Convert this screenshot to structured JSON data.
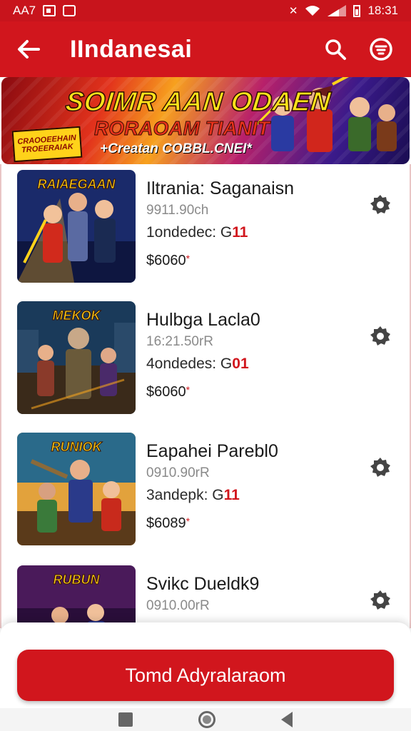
{
  "status_bar": {
    "carrier": "AA7",
    "time": "18:31"
  },
  "app_bar": {
    "title": "IIndanesai",
    "back_icon": "arrow-left-icon",
    "search_icon": "search-icon",
    "filter_icon": "filter-icon"
  },
  "banner": {
    "title": "SOIMR AAN ODAEN",
    "subtitle": "RORAOAM TIANIT",
    "tagline": "+Creatan COBBL.CNEI*",
    "badge_line1": "CRAOOEEHAIN",
    "badge_line2": "TROEERAIAK"
  },
  "games": [
    {
      "title": "Iltrania: Saganaisn",
      "meta": "9911.90ch",
      "line_prefix": "1ondedec: G",
      "line_highlight": "11",
      "price": "$6060",
      "thumb_logo": "RAIAEGAAN",
      "palette": [
        "#1a2a6a",
        "#d12a1c",
        "#f7b21e"
      ]
    },
    {
      "title": "Hulbga Laclа0",
      "meta": "16:21.50rR",
      "line_prefix": "4ondedes: G",
      "line_highlight": "01",
      "price": "$6060",
      "thumb_logo": "MEKOK",
      "palette": [
        "#1a3a5a",
        "#6a4a2a",
        "#f2a21e"
      ]
    },
    {
      "title": "Eapahei Parebl0",
      "meta": "0910.90rR",
      "line_prefix": "3andepk: G",
      "line_highlight": "11",
      "price": "$6089",
      "thumb_logo": "RUNIOK",
      "palette": [
        "#2a6a8a",
        "#e2621c",
        "#f7c21e"
      ]
    },
    {
      "title": "Svikc Dueldk9",
      "meta": "0910.00rR",
      "line_prefix": "",
      "line_highlight": "",
      "price": "",
      "thumb_logo": "RUBUN",
      "palette": [
        "#4a1a5a",
        "#d12a3c",
        "#f7a21e"
      ]
    }
  ],
  "primary_button": {
    "label": "Tomd Adyralaraom"
  },
  "colors": {
    "brand_red": "#d1161d",
    "status_red": "#c8141c"
  }
}
